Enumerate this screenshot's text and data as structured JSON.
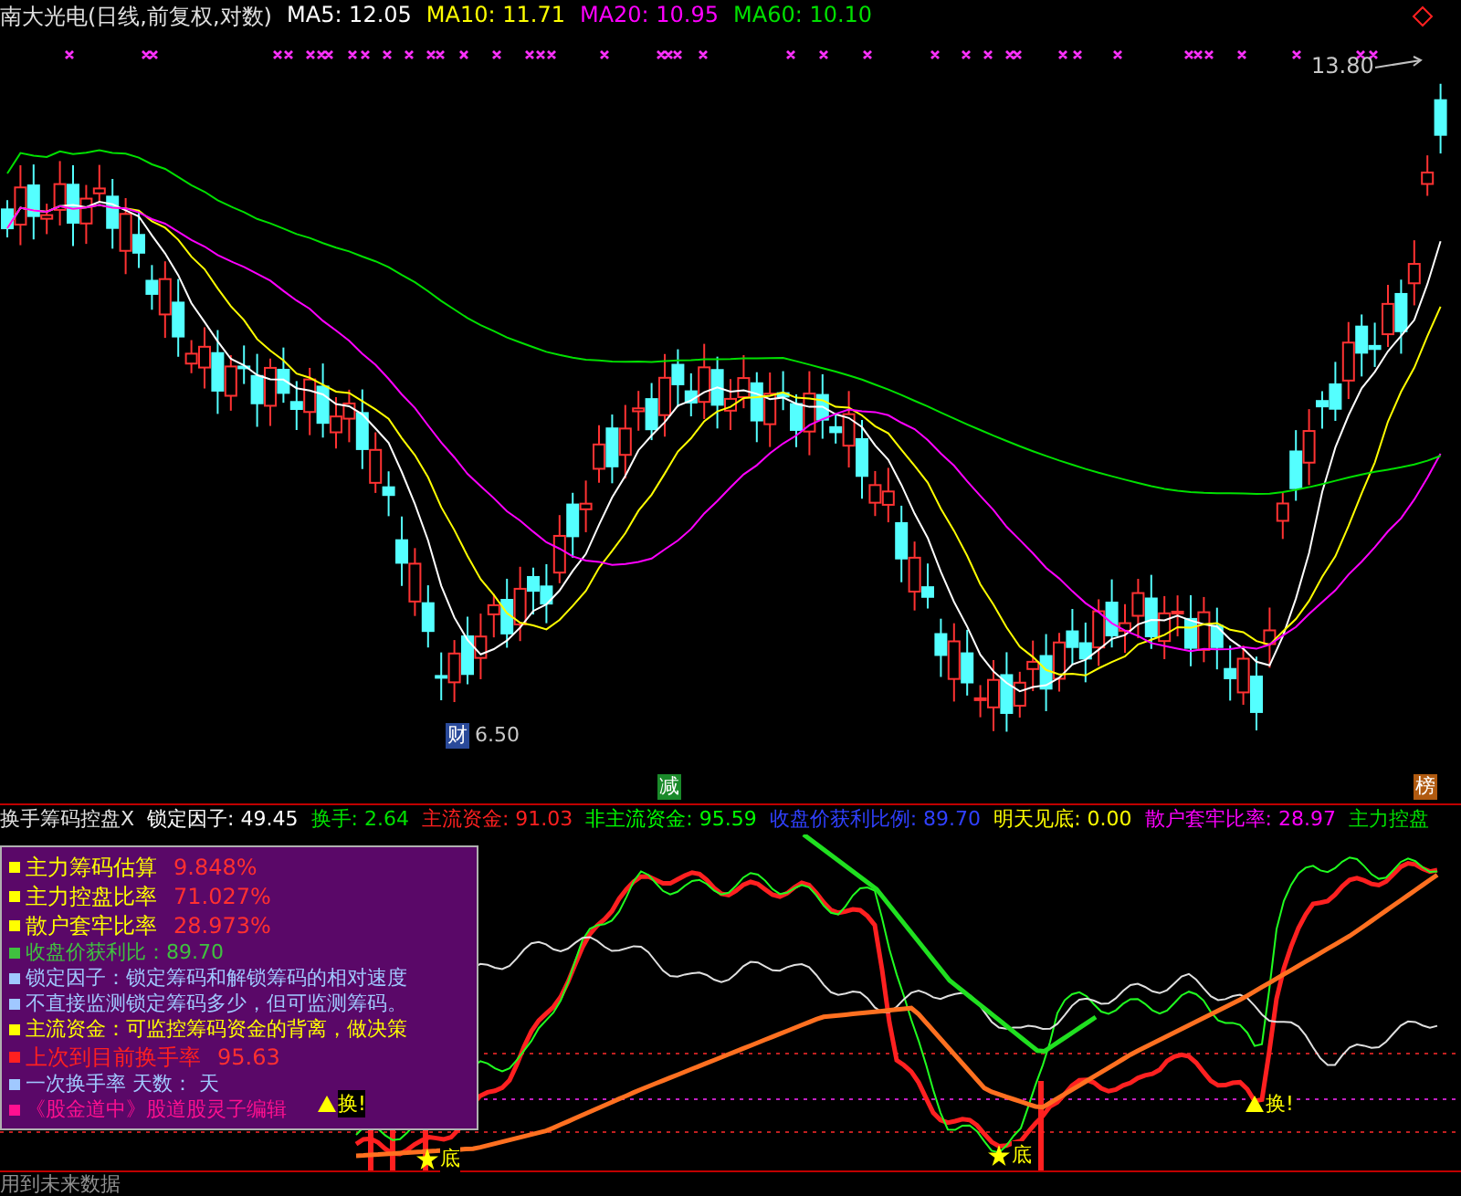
{
  "price_panel": {
    "title": "南大光电(日线,前复权,对数)",
    "ma_legend": [
      {
        "text": "MA5: 12.05",
        "color": "#ffffff"
      },
      {
        "text": "MA10: 11.71",
        "color": "#ffff00"
      },
      {
        "text": "MA20: 10.95",
        "color": "#ff00ff"
      },
      {
        "text": "MA60: 10.10",
        "color": "#00e000"
      }
    ],
    "high_label": "13.80",
    "low_label": "6.50",
    "event_badges": [
      {
        "text": "财",
        "color": "#2a4a9a"
      },
      {
        "text": "减",
        "color": "#1a8a2a"
      },
      {
        "text": "榜",
        "color": "#b05a10"
      }
    ]
  },
  "indicator_panel": {
    "legend": [
      {
        "text": "换手筹码控盘X",
        "color": "#e0e0e0"
      },
      {
        "text": "锁定因子: 49.45",
        "color": "#ffffff"
      },
      {
        "text": "换手: 2.64",
        "color": "#00e000"
      },
      {
        "text": "主流资金: 91.03",
        "color": "#ff2020"
      },
      {
        "text": "非主流资金: 95.59",
        "color": "#00ff00"
      },
      {
        "text": "收盘价获利比例: 89.70",
        "color": "#3040ff"
      },
      {
        "text": "明天见底: 0.00",
        "color": "#ffff00"
      },
      {
        "text": "散户套牢比率: 28.97",
        "color": "#ff00ff"
      },
      {
        "text": "主力控盘",
        "color": "#00e000"
      }
    ],
    "info_box": [
      {
        "kind": "stat",
        "label": "主力筹码估算",
        "value": "9.848%",
        "color": "#ffff00"
      },
      {
        "kind": "stat",
        "label": "主力控盘比率",
        "value": "71.027%",
        "color": "#ffff00"
      },
      {
        "kind": "stat",
        "label": "散户套牢比率",
        "value": "28.973%",
        "color": "#ffff00"
      },
      {
        "kind": "note",
        "text": "收盘价获利比：89.70",
        "color": "#40c040"
      },
      {
        "kind": "note",
        "text": "锁定因子：锁定筹码和解锁筹码的相对速度",
        "color": "#a0c8ff"
      },
      {
        "kind": "note",
        "text": "不直接监测锁定筹码多少，但可监测筹码。",
        "color": "#a0c8ff"
      },
      {
        "kind": "note",
        "text": "主流资金：可监控筹码资金的背离，做决策",
        "color": "#ffff00"
      },
      {
        "kind": "stat",
        "label": "上次到目前换手率",
        "value": "95.63",
        "color": "#ff2020"
      },
      {
        "kind": "note",
        "text": "一次换手率 天数： 天",
        "color": "#a0c8ff"
      },
      {
        "kind": "note",
        "text": "《股金道中》股道股灵子编辑",
        "color": "#ff1090"
      }
    ],
    "signals": [
      {
        "kind": "turnover",
        "text": "换!"
      },
      {
        "kind": "bottom",
        "text": "底"
      },
      {
        "kind": "bottom",
        "text": "底"
      },
      {
        "kind": "turnover",
        "text": "换!"
      }
    ],
    "footer": "用到未来数据"
  }
}
